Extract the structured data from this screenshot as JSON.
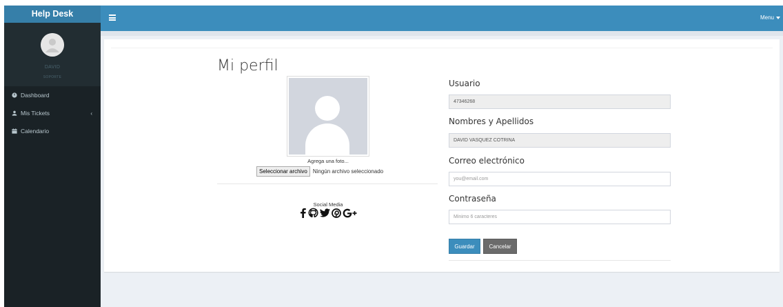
{
  "brand": "Help Desk",
  "user": {
    "name": "DAVID",
    "role": "SOPORTE"
  },
  "sidebar": {
    "items": [
      {
        "label": "Dashboard",
        "icon": "dashboard-icon"
      },
      {
        "label": "Mis Tickets",
        "icon": "user-ticket-icon",
        "chevron": "‹"
      },
      {
        "label": "Calendario",
        "icon": "calendar-icon"
      }
    ]
  },
  "topbar": {
    "menu_label": "Menu"
  },
  "profile": {
    "title": "Mi perfil",
    "photo_caption": "Agrega una foto...",
    "file_button": "Seleccionar archivo",
    "file_status": "Ningún archivo seleccionado",
    "social_label": "Social Media",
    "social_icons": [
      "facebook-icon",
      "github-icon",
      "twitter-icon",
      "pinterest-icon",
      "google-plus-icon"
    ]
  },
  "form": {
    "user_label": "Usuario",
    "user_value": "47346268",
    "names_label": "Nombres y Apellidos",
    "names_value": "DAVID VASQUEZ COTRINA",
    "email_label": "Correo electrónico",
    "email_placeholder": "you@email.com",
    "password_label": "Contraseña",
    "password_placeholder": "Minimo 6 caracteres",
    "save_label": "Guardar",
    "cancel_label": "Cancelar"
  },
  "colors": {
    "header_blue": "#3c8dbc",
    "brand_blue": "#367fa9",
    "sidebar_dark": "#222d32",
    "cancel_gray": "#6b6b6b"
  }
}
